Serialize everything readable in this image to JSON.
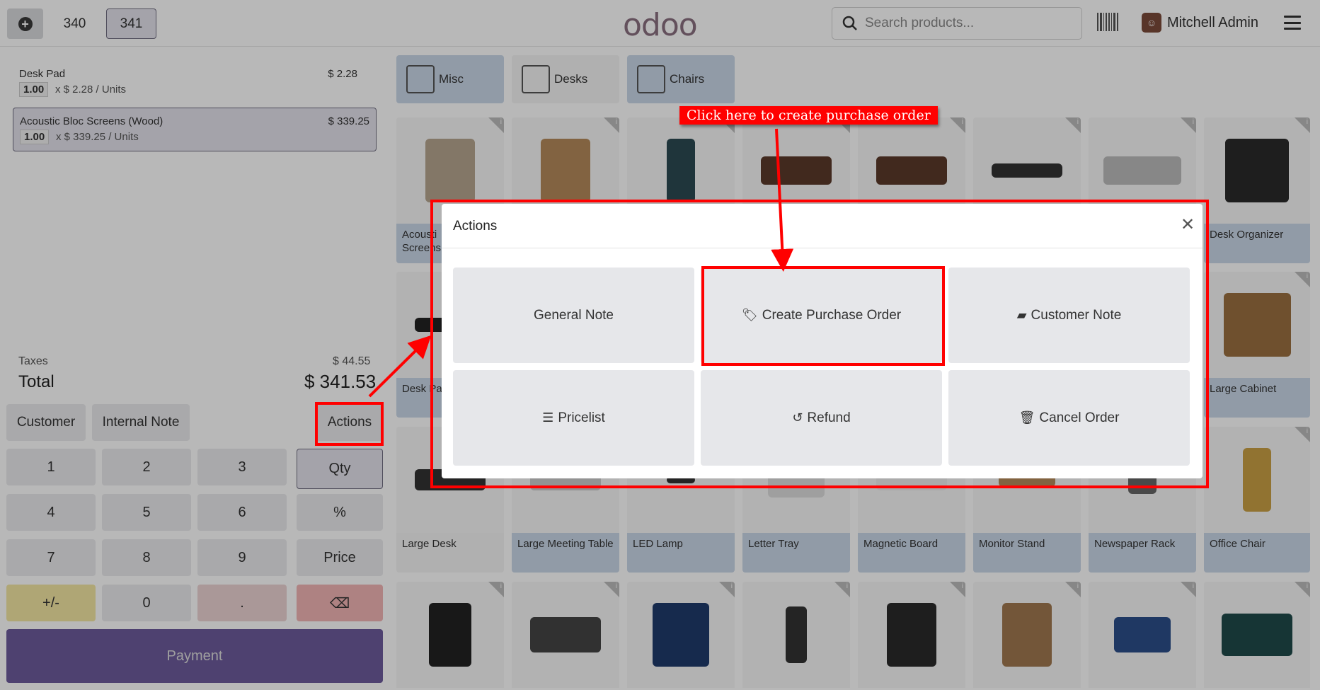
{
  "topbar": {
    "new_order_icon": "plus-circle-icon",
    "orders": [
      "340",
      "341"
    ],
    "active_order": "341",
    "logo": "odoo",
    "search_placeholder": "Search products...",
    "user_name": "Mitchell Admin"
  },
  "order": {
    "lines": [
      {
        "name": "Desk Pad",
        "price": "$ 2.28",
        "qty": "1.00",
        "unit": "x $ 2.28 / Units"
      },
      {
        "name": "Acoustic Bloc Screens (Wood)",
        "price": "$ 339.25",
        "qty": "1.00",
        "unit": "x $ 339.25 / Units"
      }
    ],
    "taxes_label": "Taxes",
    "taxes_value": "$ 44.55",
    "total_label": "Total",
    "total_value": "$ 341.53"
  },
  "controls": {
    "customer": "Customer",
    "internal_note": "Internal Note",
    "actions": "Actions"
  },
  "numpad": {
    "keys": [
      "1",
      "2",
      "3",
      "Qty",
      "4",
      "5",
      "6",
      "%",
      "7",
      "8",
      "9",
      "Price",
      "+/-",
      "0",
      ".",
      "⌫"
    ],
    "payment": "Payment"
  },
  "categories": [
    "Misc",
    "Desks",
    "Chairs"
  ],
  "products": {
    "row1_visible": [
      "Acousti",
      "Screens",
      "Desk Organizer"
    ],
    "row2_visible": [
      "Desk Pa",
      "Large Cabinet"
    ],
    "row3": [
      "Large Desk",
      "Large Meeting Table",
      "LED Lamp",
      "Letter Tray",
      "Magnetic Board",
      "Monitor Stand",
      "Newspaper Rack",
      "Office Chair"
    ]
  },
  "modal": {
    "title": "Actions",
    "buttons": [
      {
        "label": "General Note",
        "icon": ""
      },
      {
        "label": "Create Purchase Order",
        "icon": "tag-icon"
      },
      {
        "label": "Customer Note",
        "icon": "note-icon"
      },
      {
        "label": "Pricelist",
        "icon": "list-icon"
      },
      {
        "label": "Refund",
        "icon": "undo-icon"
      },
      {
        "label": "Cancel Order",
        "icon": "trash-icon"
      }
    ]
  },
  "annotation": {
    "callout": "Click here to create purchase order",
    "color": "#ff0000"
  }
}
